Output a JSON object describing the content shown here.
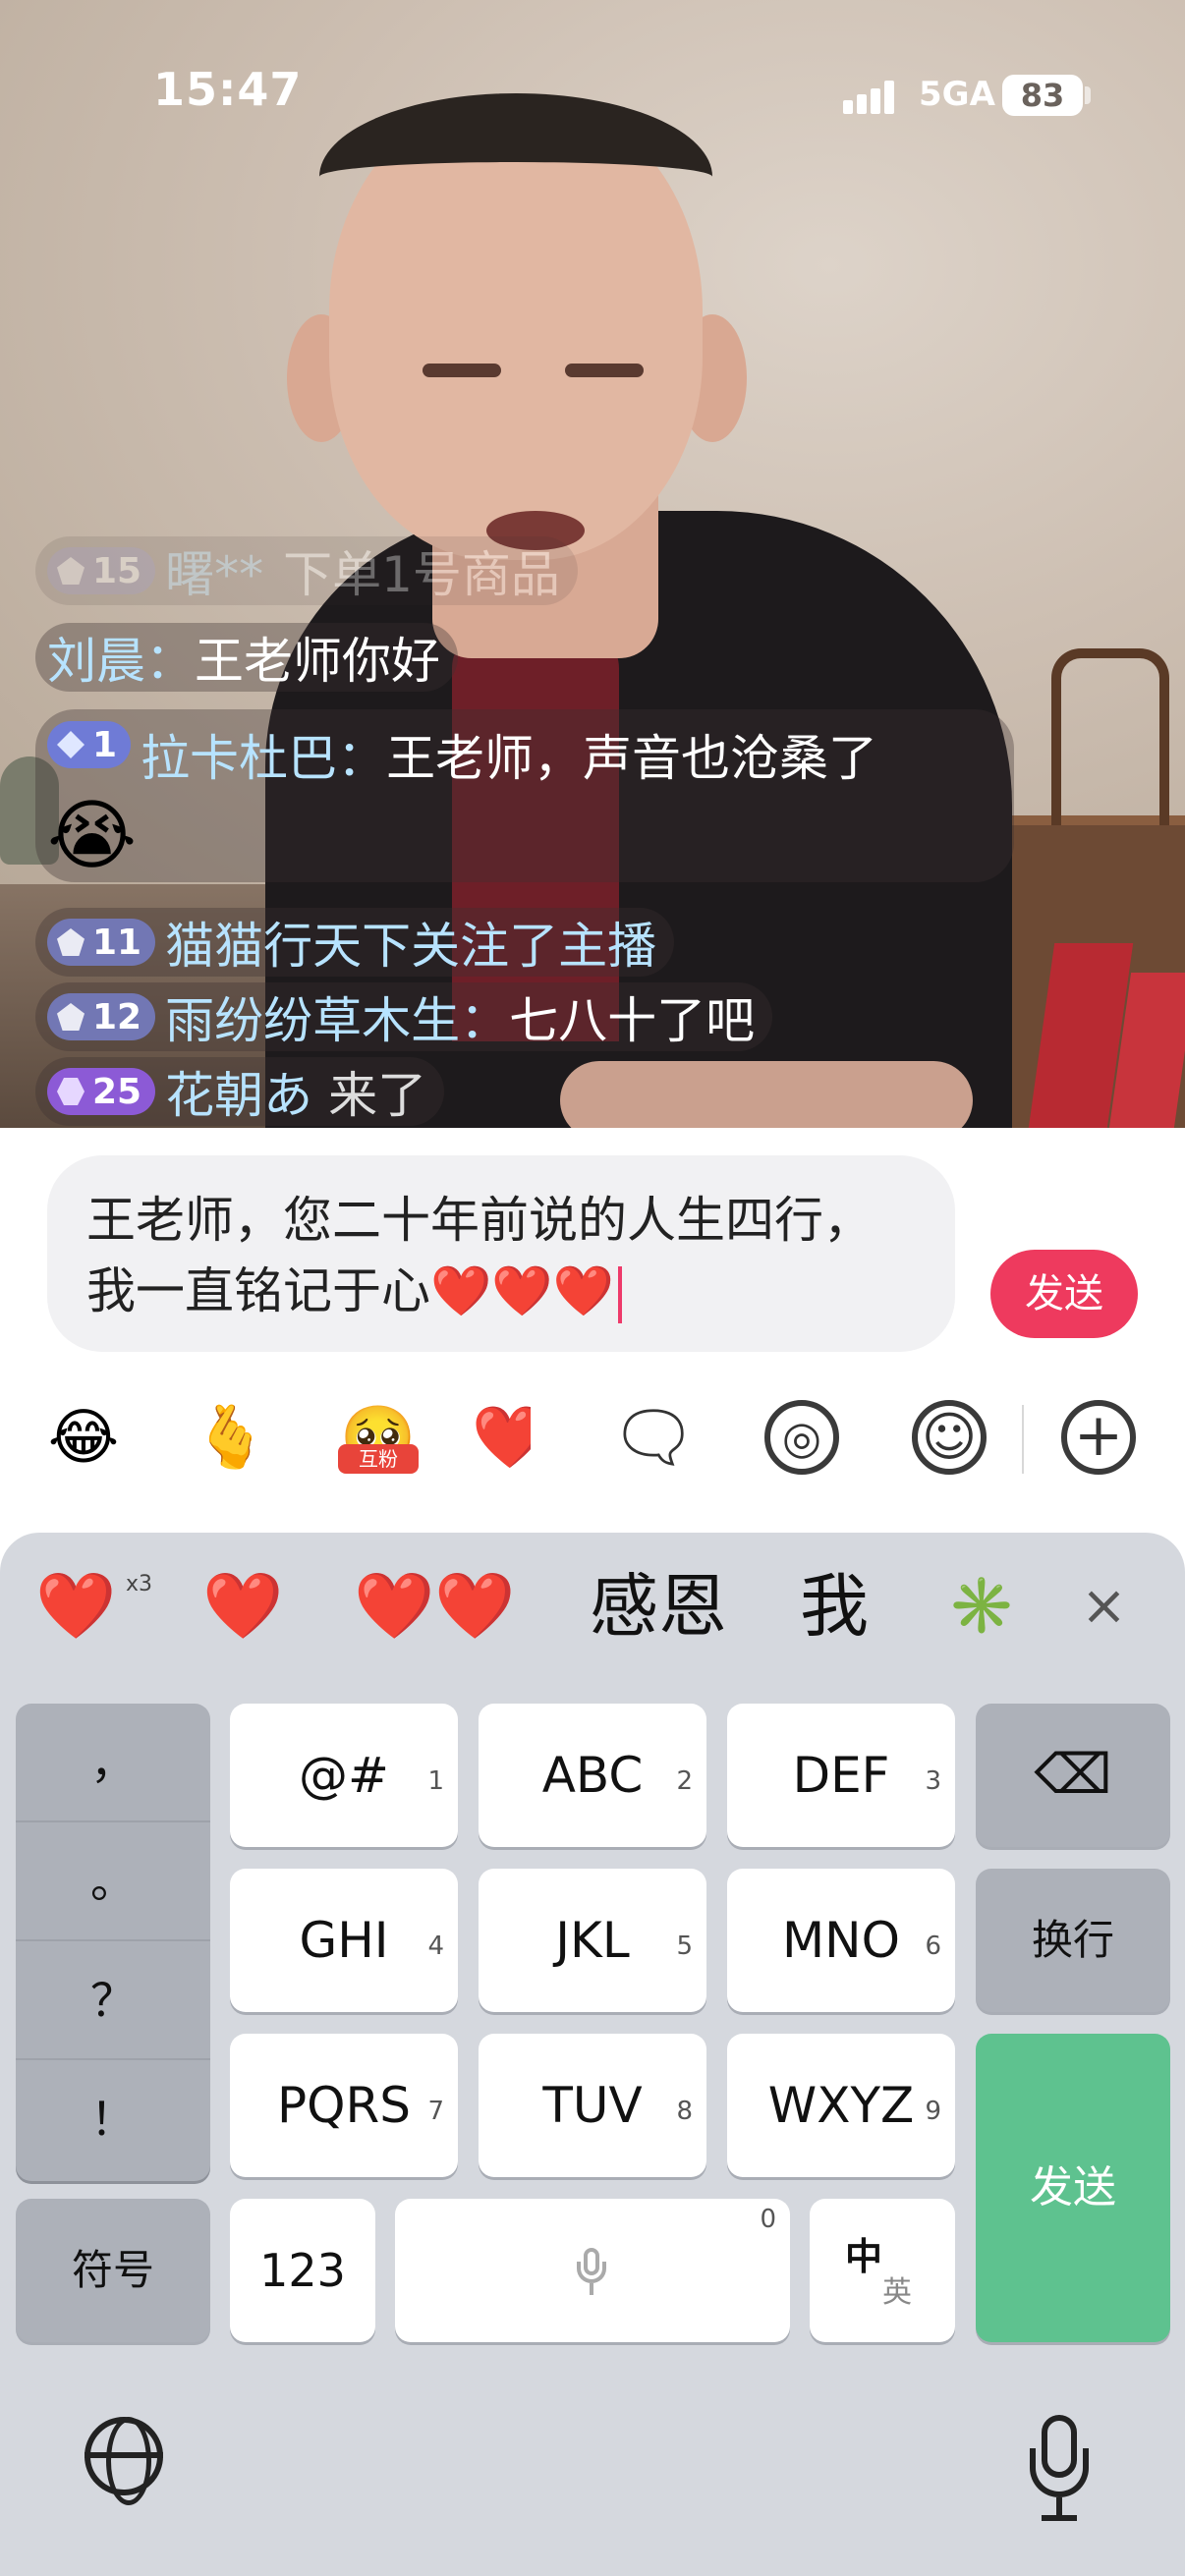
{
  "status_bar": {
    "time": "15:47",
    "network": "5GA",
    "battery": "83"
  },
  "chat": {
    "items": [
      {
        "level": "15",
        "user": "曙**",
        "sep": "",
        "text": "下单1号商品",
        "badge_color": "#8a83a8",
        "gem": "pentagon"
      },
      {
        "level": "",
        "user": "刘晨",
        "sep": "：",
        "text": "王老师你好",
        "badge_color": "",
        "gem": ""
      },
      {
        "level": "1",
        "user": "拉卡杜巴",
        "sep": "：",
        "text": "王老师，声音也沧桑了",
        "badge_color": "#6f7bd6",
        "gem": "diamond",
        "emoji": "😭"
      },
      {
        "level": "11",
        "user": "猫猫行天下",
        "sep": "",
        "text": "关注了主播",
        "badge_color": "#7277b4",
        "gem": "pentagon"
      },
      {
        "level": "12",
        "user": "雨纷纷草木生",
        "sep": "：",
        "text": "七八十了吧",
        "badge_color": "#7277b4",
        "gem": "pentagon"
      },
      {
        "level": "25",
        "user": "花朝あ",
        "sep": "",
        "text": "来了",
        "badge_color": "#8c5ad6",
        "gem": "hex"
      }
    ]
  },
  "composer": {
    "text": "王老师，您二十年前说的人生四行，我一直铭记于心❤️❤️❤️",
    "send_label": "发送"
  },
  "toolbar": {
    "items": [
      {
        "name": "laugh-cry-emoji-icon",
        "glyph": "😂"
      },
      {
        "name": "finger-heart-icon",
        "glyph": "🫰"
      },
      {
        "name": "hufen-sticker-icon",
        "glyph": "🥺",
        "label": "互粉"
      },
      {
        "name": "heart-sticker-icon",
        "glyph": "❤️"
      },
      {
        "name": "sticker-icon",
        "glyph": "🗨"
      },
      {
        "name": "voice-wave-icon",
        "glyph": "◎"
      },
      {
        "name": "smiley-icon",
        "glyph": "☺"
      },
      {
        "name": "plus-icon",
        "glyph": "+"
      }
    ]
  },
  "keyboard": {
    "candidates": [
      "❤️",
      "❤️",
      "❤️❤️",
      "感恩",
      "我",
      "✳️"
    ],
    "candidate_multiplier": "x3",
    "close": "×",
    "punctuation": [
      "，",
      "。",
      "？",
      "！"
    ],
    "keys": [
      {
        "label": "@#",
        "num": "1"
      },
      {
        "label": "ABC",
        "num": "2"
      },
      {
        "label": "DEF",
        "num": "3"
      },
      {
        "label": "GHI",
        "num": "4"
      },
      {
        "label": "JKL",
        "num": "5"
      },
      {
        "label": "MNO",
        "num": "6"
      },
      {
        "label": "PQRS",
        "num": "7"
      },
      {
        "label": "TUV",
        "num": "8"
      },
      {
        "label": "WXYZ",
        "num": "9"
      }
    ],
    "symbols_label": "符号",
    "num_label": "123",
    "space_num": "0",
    "lang_primary": "中",
    "lang_secondary": "英",
    "newline_label": "换行",
    "send_label": "发送",
    "backspace": "⌫"
  },
  "colors": {
    "accent": "#ee3a5e",
    "send_green": "#5ec28f",
    "username": "#b7e3ff"
  }
}
